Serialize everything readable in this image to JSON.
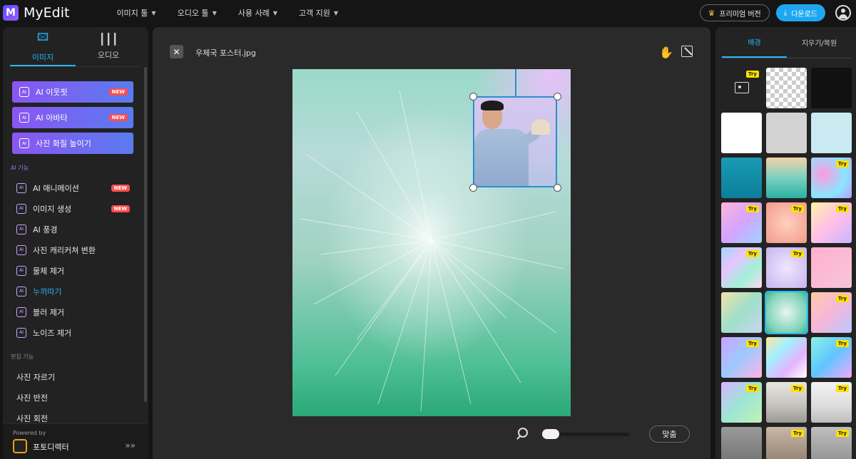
{
  "app": {
    "name": "MyEdit",
    "logo_letter": "M"
  },
  "nav": [
    {
      "label": "이미지 툴"
    },
    {
      "label": "오디오 툴"
    },
    {
      "label": "사용 사례"
    },
    {
      "label": "고객 지원"
    }
  ],
  "header": {
    "premium_label": "프리미엄 버전",
    "download_label": "다운로드"
  },
  "sidebar": {
    "tabs": [
      {
        "label": "이미지",
        "icon": "image-icon",
        "active": true
      },
      {
        "label": "오디오",
        "icon": "waveform-icon",
        "active": false
      }
    ],
    "featured": [
      {
        "label": "AI 이웃핏",
        "badge": "NEW"
      },
      {
        "label": "AI 아바타",
        "badge": "NEW"
      },
      {
        "label": "사진 화질 높이기",
        "badge": ""
      }
    ],
    "ai_section_label": "AI 기능",
    "ai_items": [
      {
        "label": "AI 애니메이션",
        "badge": "NEW"
      },
      {
        "label": "이미지 생성",
        "badge": "NEW"
      },
      {
        "label": "AI 풍경",
        "badge": ""
      },
      {
        "label": "사진 캐리커쳐 변환",
        "badge": ""
      },
      {
        "label": "물체 제거",
        "badge": ""
      },
      {
        "label": "누끼따기",
        "badge": "",
        "active": true
      },
      {
        "label": "블러 제거",
        "badge": ""
      },
      {
        "label": "노이즈 제거",
        "badge": ""
      }
    ],
    "edit_section_label": "편집 기능",
    "edit_items": [
      {
        "label": "사진 자르기"
      },
      {
        "label": "사진 반전"
      },
      {
        "label": "사진 회전"
      }
    ],
    "footer": {
      "powered": "Powered by",
      "brand": "포토디렉터"
    }
  },
  "canvas": {
    "file_name": "우체국 포스터.jpg",
    "fit_label": "맞춤",
    "zoom_fraction": 0.0
  },
  "right_panel": {
    "tabs": [
      {
        "label": "배경",
        "active": true
      },
      {
        "label": "지우기/복원",
        "active": false
      }
    ],
    "try_label": "Try"
  },
  "colors": {
    "accent": "#25b6f5",
    "new_badge": "#ff4d4d",
    "try_badge": "#ffe100"
  }
}
